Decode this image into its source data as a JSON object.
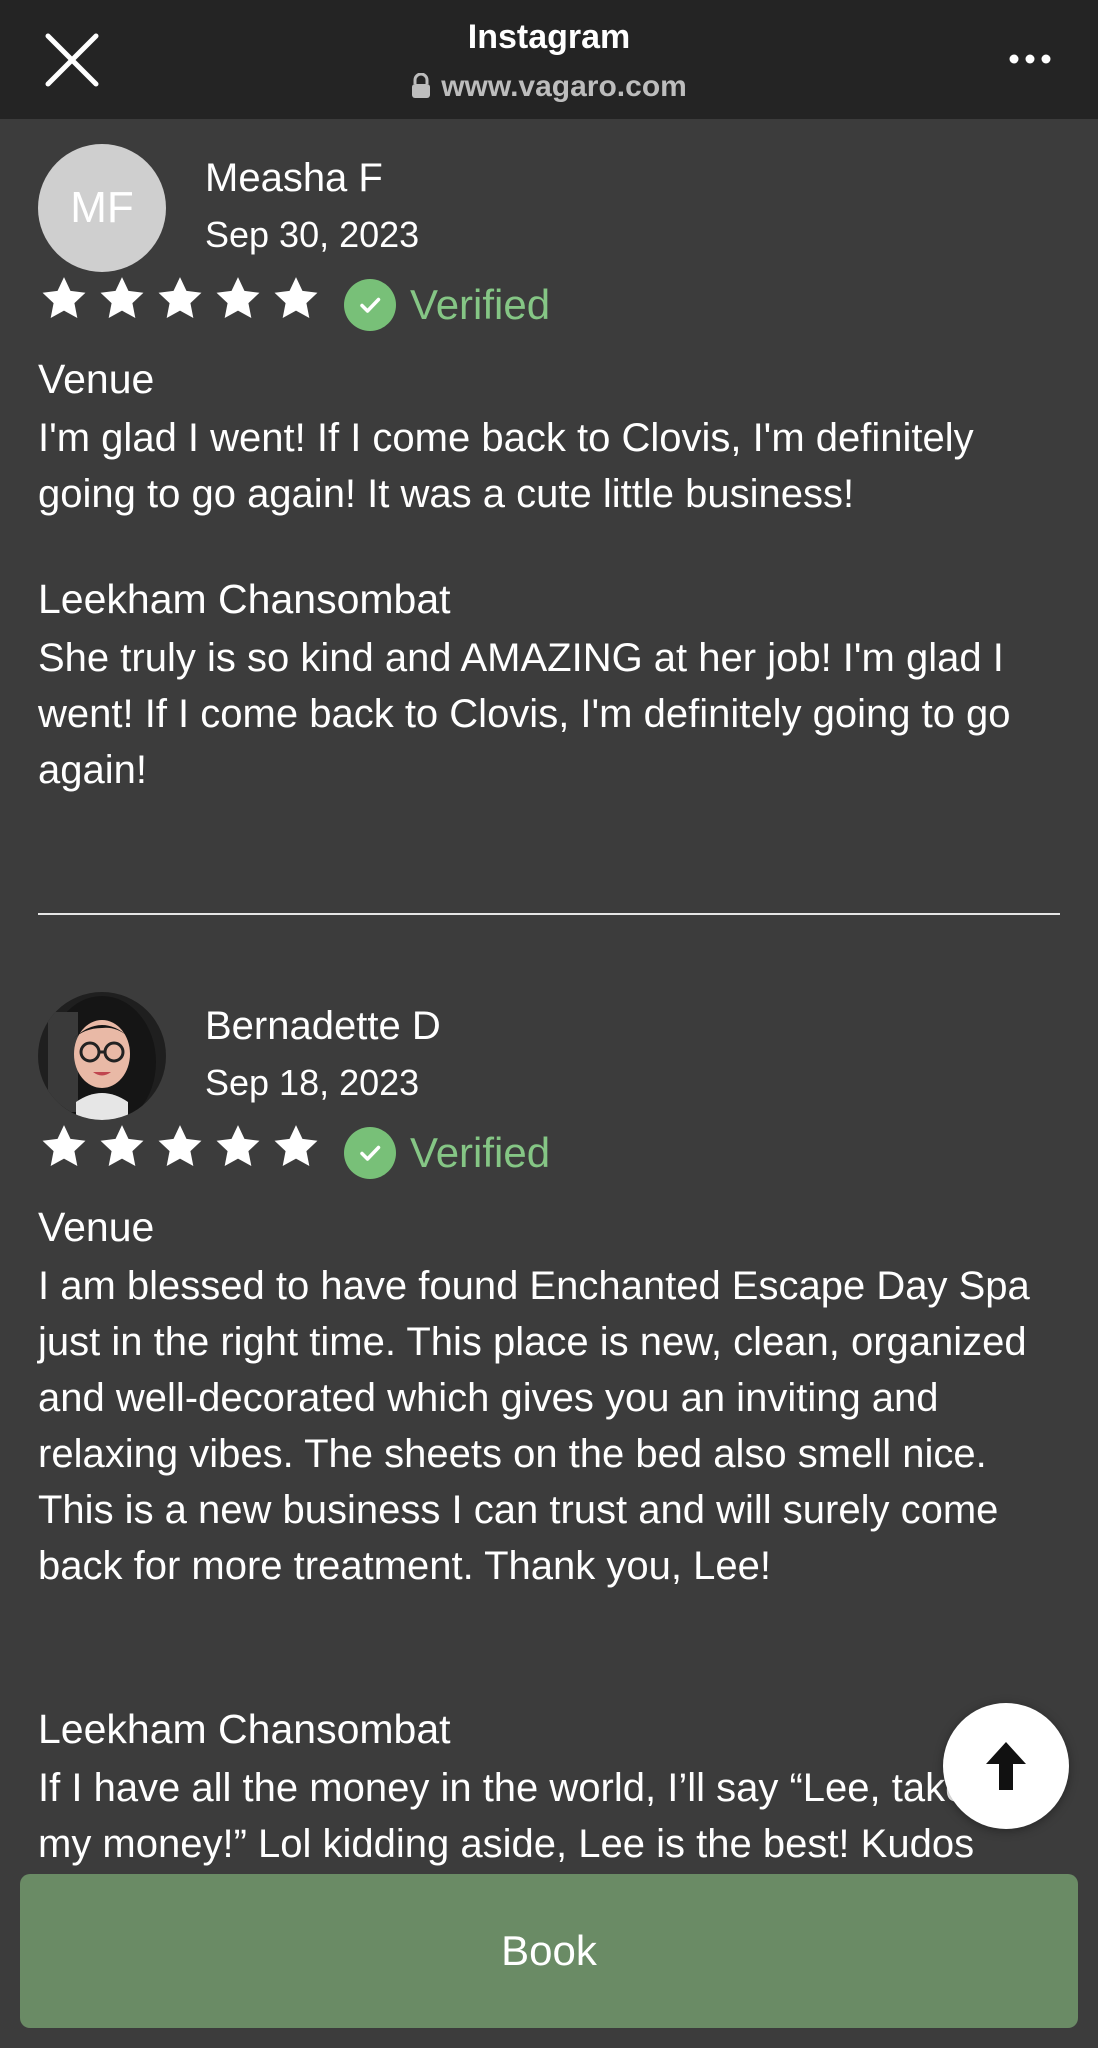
{
  "topbar": {
    "title": "Instagram",
    "url": "www.vagaro.com"
  },
  "reviews": [
    {
      "initials": "MF",
      "name": "Measha F",
      "date": "Sep 30, 2023",
      "rating": 5,
      "verified_label": "Verified",
      "sections": [
        {
          "title": "Venue",
          "body": "I'm glad I went! If I come back to Clovis, I'm definitely going to go again! It was a cute little business!"
        },
        {
          "title": "Leekham Chansombat",
          "body": "She truly is so kind and AMAZING at her job! I'm glad I went! If I come back to Clovis, I'm definitely going to go again!"
        }
      ]
    },
    {
      "initials": "",
      "name": "Bernadette D",
      "date": "Sep 18, 2023",
      "rating": 5,
      "verified_label": "Verified",
      "sections": [
        {
          "title": "Venue",
          "body": "I am blessed to have found Enchanted Escape Day Spa just in the right time. This place is new, clean, organized and well-decorated which gives you an inviting and relaxing vibes. The sheets on the bed also smell nice. This is a new business I can trust and will surely come back for more treatment. Thank you, Lee!"
        },
        {
          "title": "Leekham Chansombat",
          "body": "If I have all the money in the world, I’ll say “Lee, take all my money!” Lol kidding aside, Lee is the best! Kudos"
        }
      ]
    }
  ],
  "book_label": "Book",
  "colors": {
    "background": "#3c3c3c",
    "topbar": "#242424",
    "verified_green": "#78c078",
    "book_button": "#6a8b65"
  },
  "icons": [
    "close-icon",
    "lock-icon",
    "more-icon",
    "star-icon",
    "check-icon",
    "arrow-up-icon"
  ]
}
